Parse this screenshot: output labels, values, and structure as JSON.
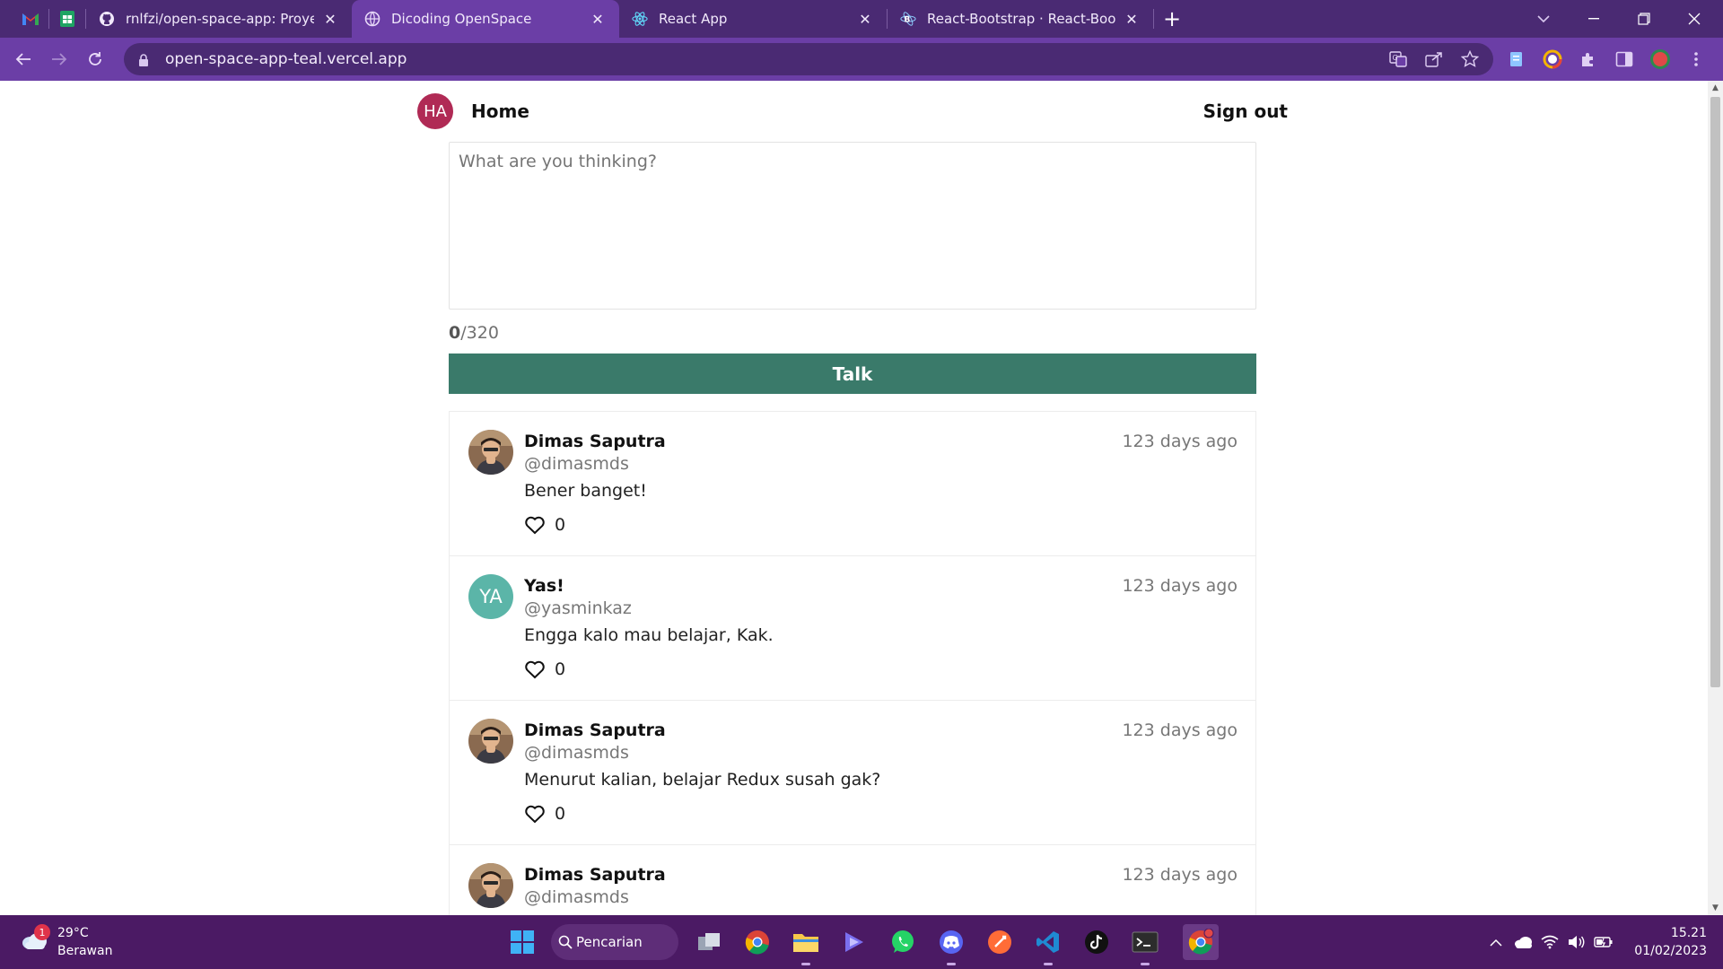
{
  "browser": {
    "tabs": [
      {
        "title": "rnlfzi/open-space-app: Proyek lat",
        "active": false,
        "favicon": "github-icon"
      },
      {
        "title": "Dicoding OpenSpace",
        "active": true,
        "favicon": "globe-icon"
      },
      {
        "title": "React App",
        "active": false,
        "favicon": "react-icon"
      },
      {
        "title": "React-Bootstrap · React-Bootstra",
        "active": false,
        "favicon": "bootstrap-icon"
      }
    ],
    "url": "open-space-app-teal.vercel.app",
    "new_tab": "+"
  },
  "page": {
    "nav": {
      "avatar_initials": "HA",
      "home_label": "Home",
      "signout_label": "Sign out"
    },
    "composer": {
      "placeholder": "What are you thinking?",
      "value": "",
      "char_count": "0",
      "char_limit": "/320",
      "submit_label": "Talk"
    },
    "threads": [
      {
        "name": "Dimas Saputra",
        "username": "@dimasmds",
        "time": "123 days ago",
        "text": "Bener banget!",
        "likes": "0",
        "avatar": "photo"
      },
      {
        "name": "Yas!",
        "username": "@yasminkaz",
        "time": "123 days ago",
        "text": "Engga kalo mau belajar, Kak.",
        "likes": "0",
        "avatar": "YA"
      },
      {
        "name": "Dimas Saputra",
        "username": "@dimasmds",
        "time": "123 days ago",
        "text": "Menurut kalian, belajar Redux susah gak?",
        "likes": "0",
        "avatar": "photo"
      },
      {
        "name": "Dimas Saputra",
        "username": "@dimasmds",
        "time": "123 days ago",
        "text": "",
        "likes": "",
        "avatar": "photo"
      }
    ]
  },
  "taskbar": {
    "weather_temp": "29°C",
    "weather_cond": "Berawan",
    "weather_badge": "1",
    "search_label": "Pencarian",
    "time": "15.21",
    "date": "01/02/2023"
  },
  "colors": {
    "tabstrip": "#4a2a73",
    "toolbar": "#6b3ea6",
    "talk_button": "#3a7a6a",
    "user_avatar": "#b02a55",
    "initials_avatar": "#5bb5a8",
    "taskbar": "#4b1a64"
  }
}
